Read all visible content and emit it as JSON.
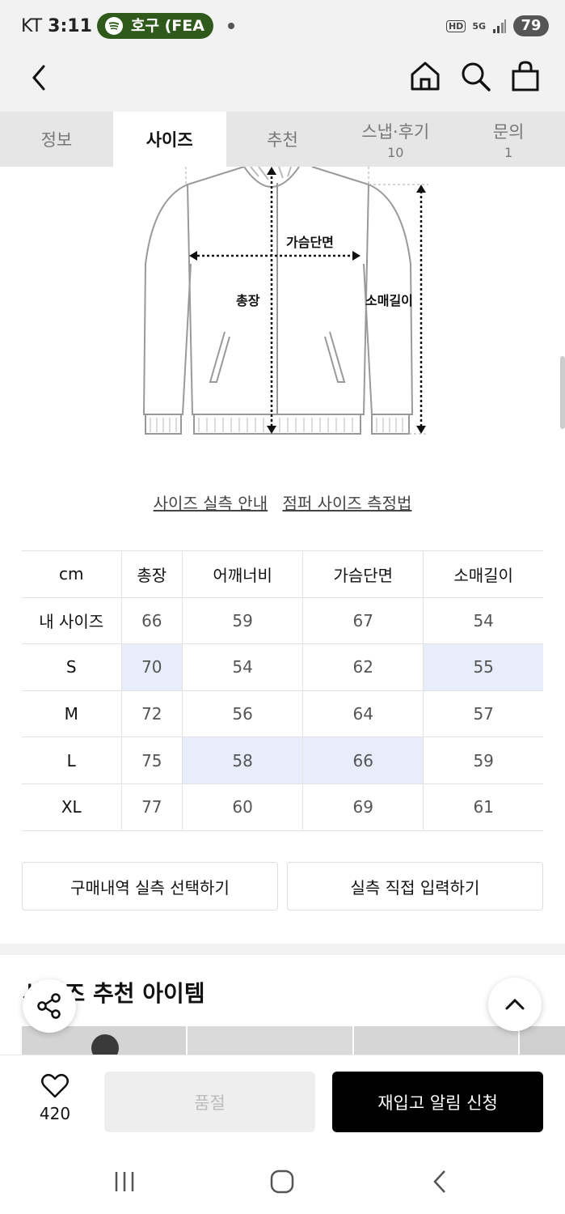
{
  "status_bar": {
    "carrier": "KT",
    "time": "3:11",
    "media_pill": "호구 (FEA",
    "network_hd": "HD",
    "network_5g": "5G",
    "battery": "79"
  },
  "tabs": [
    {
      "label": "정보",
      "count": ""
    },
    {
      "label": "사이즈",
      "count": ""
    },
    {
      "label": "추천",
      "count": ""
    },
    {
      "label": "스냅·후기",
      "count": "10"
    },
    {
      "label": "문의",
      "count": "1"
    }
  ],
  "active_tab": "사이즈",
  "diagram": {
    "chest_label": "가슴단면",
    "length_label": "총장",
    "sleeve_label": "소매길이"
  },
  "links": {
    "size_guide": "사이즈 실측 안내",
    "measure_method": "점퍼 사이즈 측정법"
  },
  "size_table": {
    "headers": [
      "cm",
      "총장",
      "어깨너비",
      "가슴단면",
      "소매길이"
    ],
    "rows": [
      {
        "size": "내 사이즈",
        "values": [
          "66",
          "59",
          "67",
          "54"
        ]
      },
      {
        "size": "S",
        "values": [
          "70",
          "54",
          "62",
          "55"
        ]
      },
      {
        "size": "M",
        "values": [
          "72",
          "56",
          "64",
          "57"
        ]
      },
      {
        "size": "L",
        "values": [
          "75",
          "58",
          "66",
          "59"
        ]
      },
      {
        "size": "XL",
        "values": [
          "77",
          "60",
          "69",
          "61"
        ]
      }
    ],
    "highlight_color": "#e8edfc"
  },
  "buttons": {
    "select_purchase": "구매내역 실측 선택하기",
    "direct_input": "실측 직접 입력하기",
    "soldout": "품절",
    "restock": "재입고 알림 신청"
  },
  "recommend": {
    "title": "사이즈 추천 아이템"
  },
  "like_count": "420"
}
